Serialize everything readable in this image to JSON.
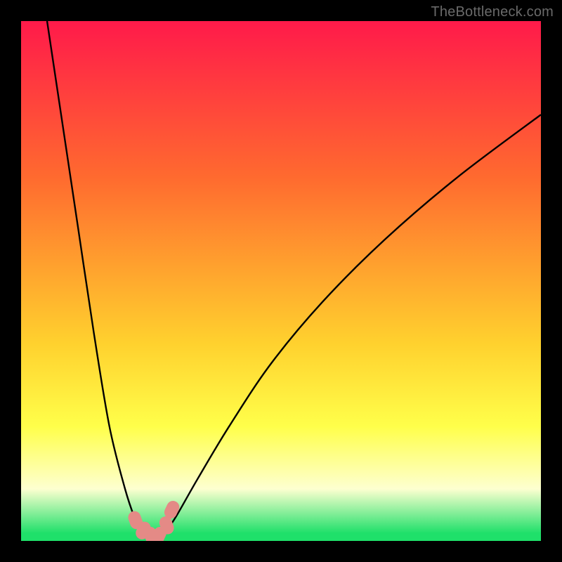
{
  "watermark": "TheBottleneck.com",
  "colors": {
    "black": "#000000",
    "curve": "#000000",
    "marker": "#e48a86",
    "grad_top": "#ff1a4a",
    "grad_mid1": "#ff6a2f",
    "grad_mid2": "#ffd12e",
    "grad_yellow": "#ffff4a",
    "grad_pale": "#fdffd0",
    "grad_green": "#1fe06a",
    "watermark_color": "#6a6a6a"
  },
  "chart_data": {
    "type": "line",
    "title": "",
    "xlabel": "",
    "ylabel": "",
    "xlim": [
      0,
      100
    ],
    "ylim": [
      0,
      100
    ],
    "series": [
      {
        "name": "bottleneck-curve",
        "x": [
          5,
          8,
          11,
          14,
          17,
          20,
          22,
          23,
          24,
          25,
          26,
          27,
          28,
          30,
          34,
          40,
          48,
          58,
          70,
          84,
          100
        ],
        "y": [
          100,
          80,
          60,
          40,
          22,
          10,
          4,
          2,
          1,
          0.8,
          0.8,
          1,
          2,
          5,
          12,
          22,
          34,
          46,
          58,
          70,
          82
        ]
      }
    ],
    "markers": {
      "name": "highlight-points",
      "x": [
        22,
        23.5,
        25,
        26.5,
        28,
        29
      ],
      "y": [
        4,
        2,
        1,
        1,
        3,
        6
      ]
    },
    "background_gradient_stops": [
      {
        "pos": 0.0,
        "color": "#ff1a4a"
      },
      {
        "pos": 0.3,
        "color": "#ff6a2f"
      },
      {
        "pos": 0.62,
        "color": "#ffd12e"
      },
      {
        "pos": 0.78,
        "color": "#ffff4a"
      },
      {
        "pos": 0.9,
        "color": "#fdffd0"
      },
      {
        "pos": 0.985,
        "color": "#1fe06a"
      }
    ]
  }
}
